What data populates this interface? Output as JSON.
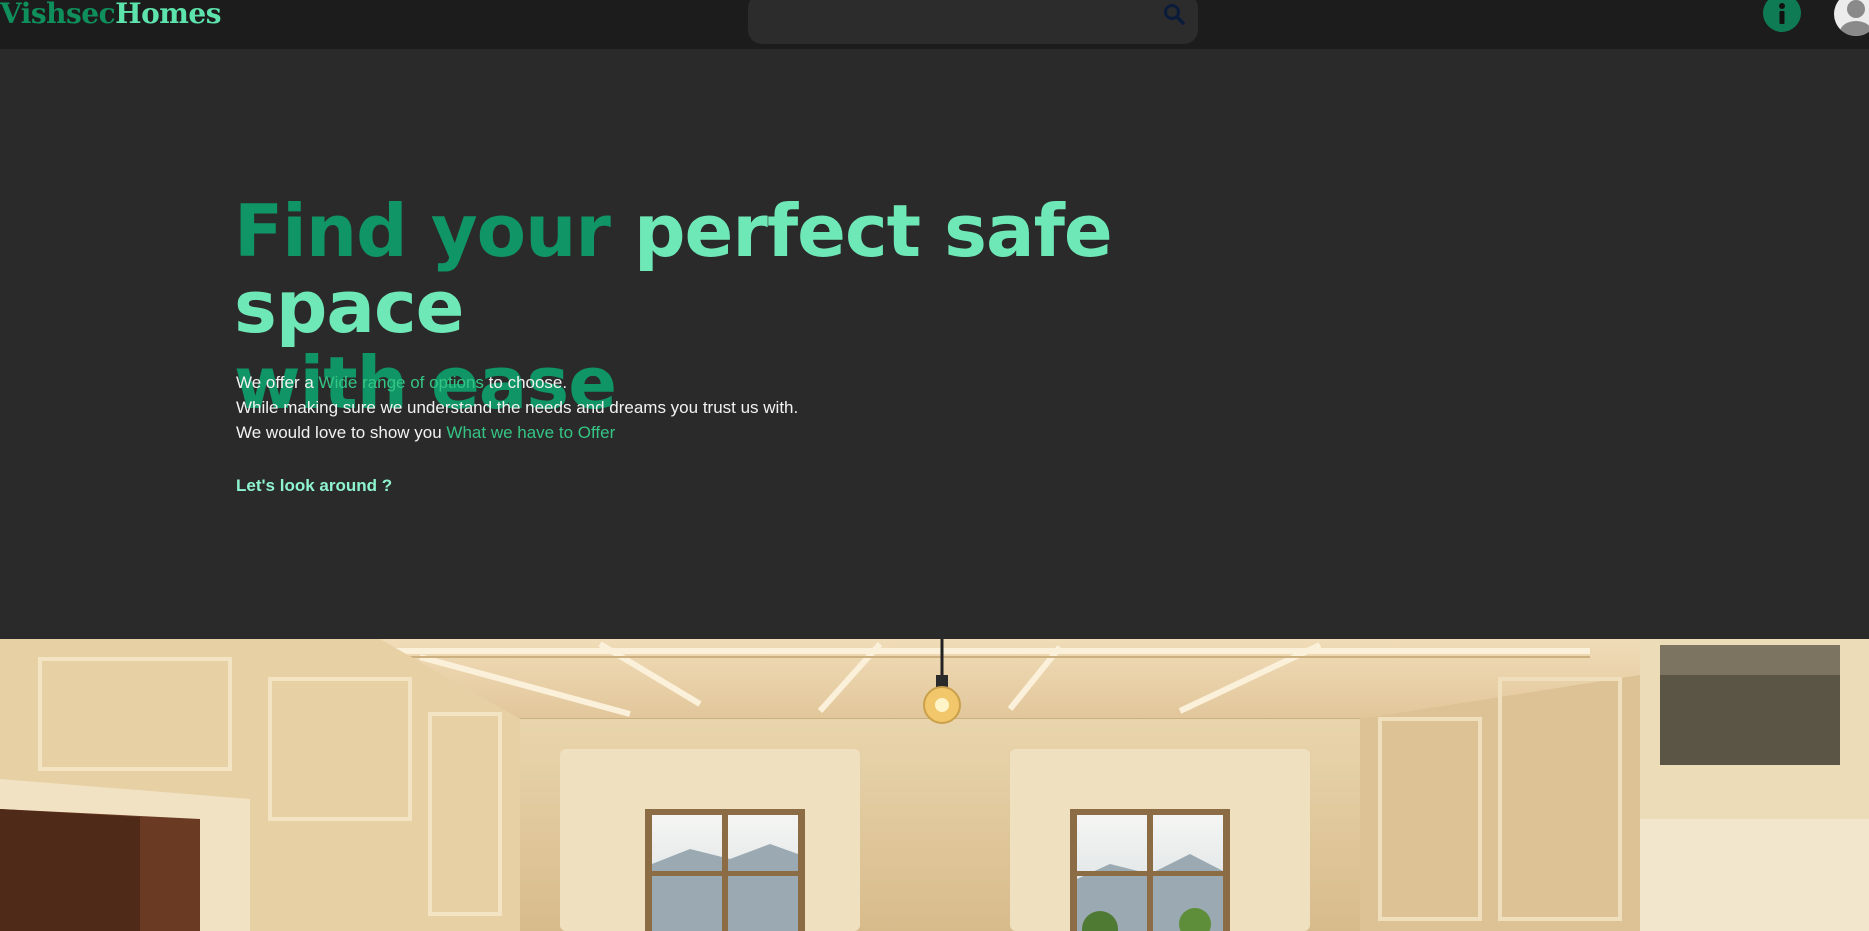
{
  "brand": {
    "part1": "Vishsec",
    "part2": "Homes"
  },
  "header": {
    "search_placeholder": "",
    "icons": {
      "search": "search-icon",
      "info": "info-icon",
      "avatar": "user-avatar-icon"
    }
  },
  "hero": {
    "headline_part1": "Find your",
    "headline_part2": "perfect safe space",
    "headline_part3": "with ease",
    "line1_prefix": "We offer a",
    "line1_highlight": "Wide range of options",
    "line1_suffix": "to choose.",
    "line2": "While making sure we understand the needs and dreams you trust us with.",
    "line3_prefix": "We would love to show you",
    "line3_highlight": "What we have to Offer",
    "cta": "Let's look around ?"
  },
  "colors": {
    "brand_dark": "#0f8f5c",
    "brand_light": "#5de3ac",
    "headline_dark": "#0f9566",
    "headline_light": "#6fe8b8",
    "highlight": "#34c585",
    "cta": "#8ef3cf",
    "background": "#2a2a2a",
    "topbar": "#1c1c1c"
  }
}
